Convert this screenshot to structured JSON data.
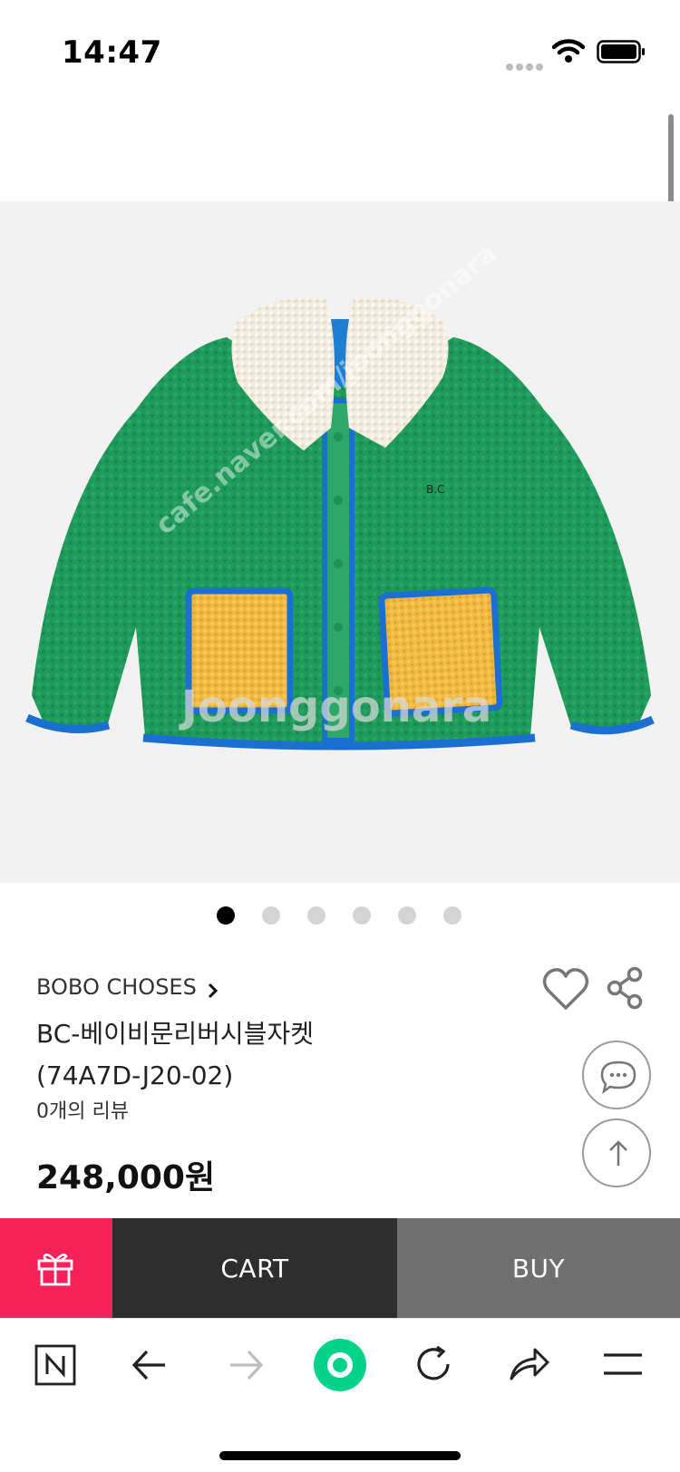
{
  "status_bar": {
    "time": "14:47",
    "icons": [
      "signal-dots-icon",
      "wifi-icon",
      "battery-icon"
    ]
  },
  "product": {
    "image_watermarks": [
      "cafe.naver.com/joonggonara",
      "Joonggonara"
    ],
    "pager": {
      "total": 6,
      "active_index": 0
    },
    "brand": "BOBO CHOSES",
    "name_line1": "BC-베이비문리버시블자켓",
    "name_line2": "(74A7D-J20-02)",
    "review_count": "0개의 리뷰",
    "price": "248,000원",
    "icons": [
      "heart-icon",
      "share-icon",
      "chat-icon",
      "arrow-up-icon"
    ]
  },
  "buy_bar": {
    "gift_icon": "gift-icon",
    "cart_label": "CART",
    "buy_label": "BUY",
    "colors": {
      "gift": "#f5225a",
      "cart": "#2e2e2e",
      "buy": "#6f6f6f"
    }
  },
  "browser_toolbar": {
    "items": [
      "naver-n-icon",
      "back-arrow-icon",
      "forward-arrow-icon",
      "green-dot-icon",
      "refresh-icon",
      "share-arrow-icon",
      "menu-icon"
    ],
    "accent_color": "#03d28a"
  }
}
